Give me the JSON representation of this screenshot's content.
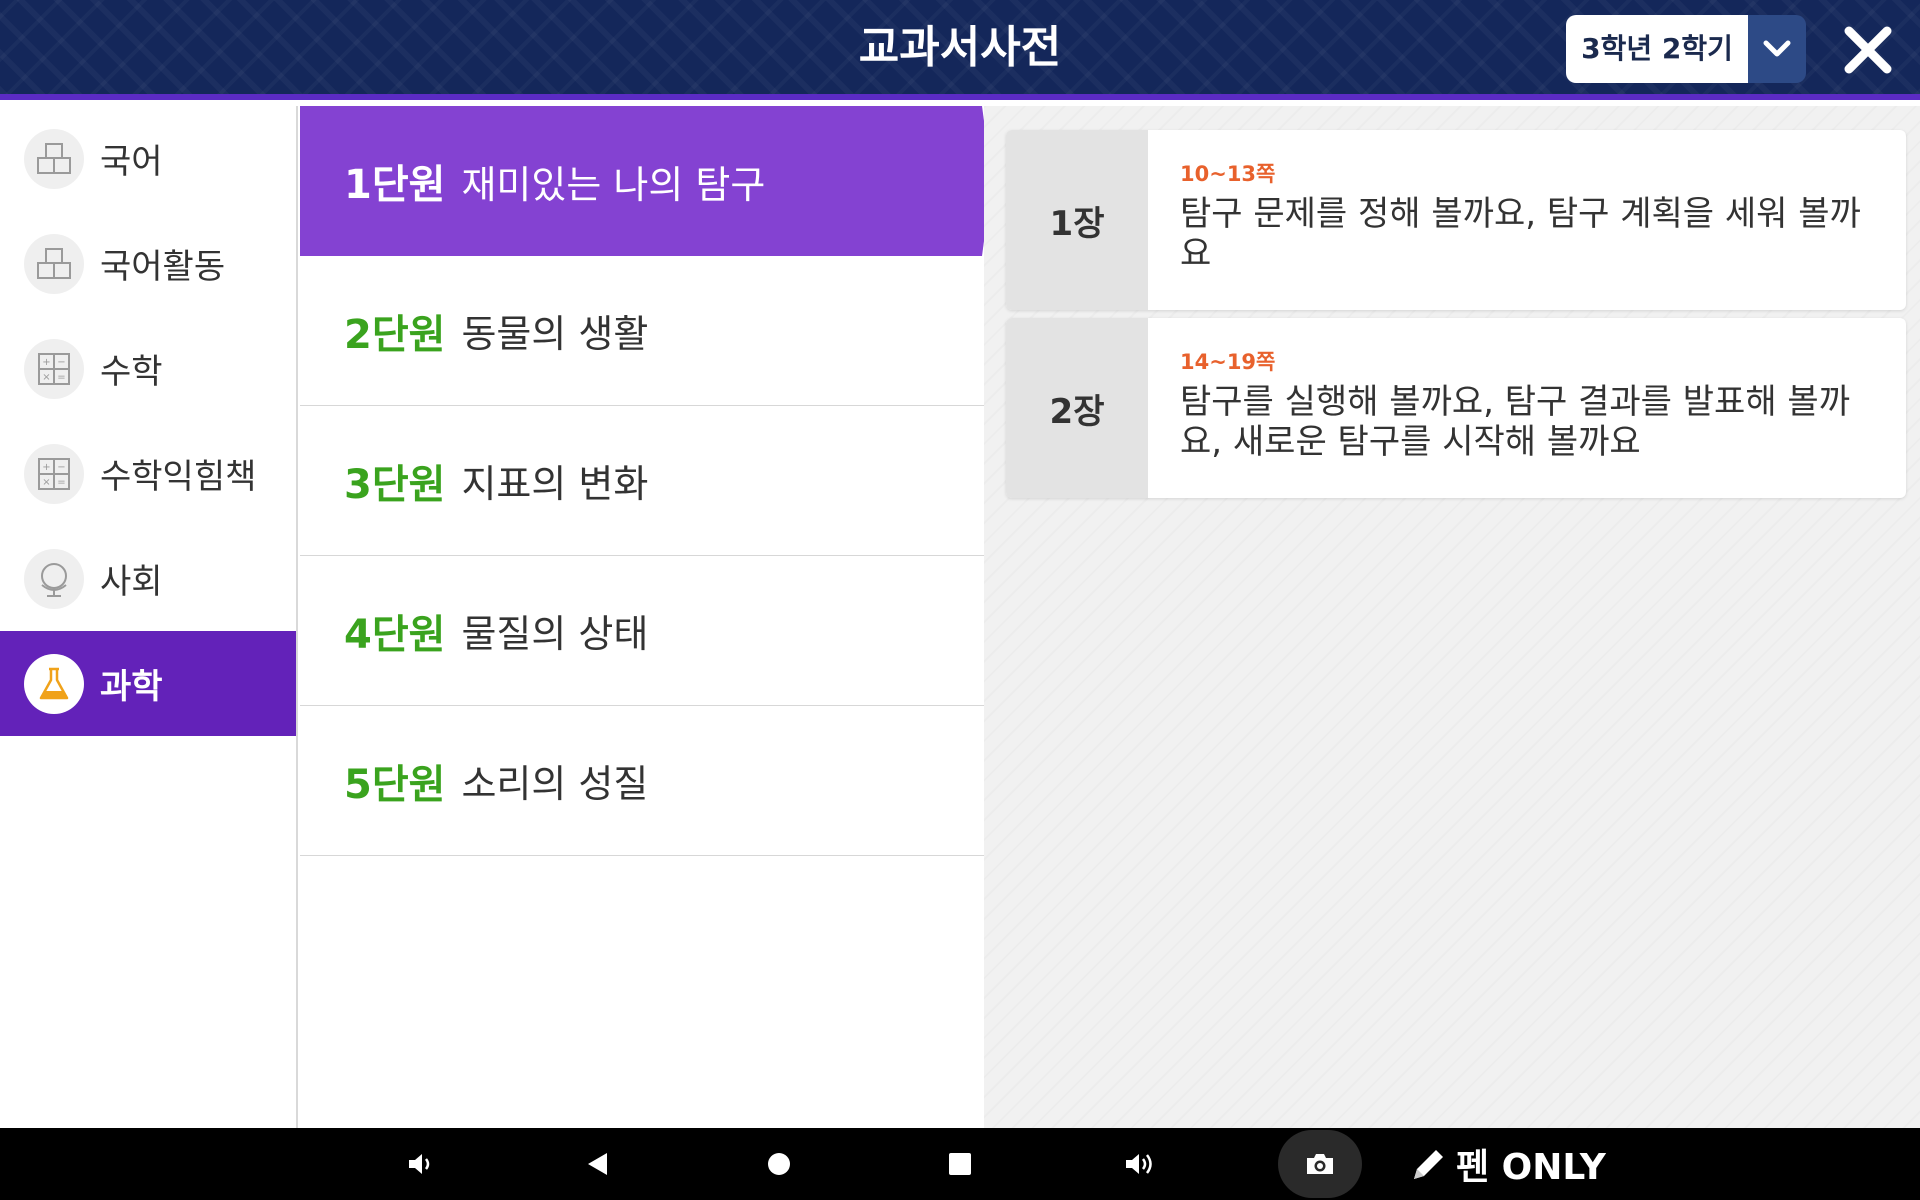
{
  "header": {
    "title": "교과서사전",
    "grade_select": "3학년 2학기",
    "accent_color": "#5b2bc4"
  },
  "subjects": [
    {
      "label": "국어",
      "icon": "textbook-icon",
      "active": false
    },
    {
      "label": "국어활동",
      "icon": "textbook-icon",
      "active": false
    },
    {
      "label": "수학",
      "icon": "calculator-icon",
      "active": false
    },
    {
      "label": "수학익힘책",
      "icon": "calculator-icon",
      "active": false
    },
    {
      "label": "사회",
      "icon": "globe-icon",
      "active": false
    },
    {
      "label": "과학",
      "icon": "flask-icon",
      "active": true
    }
  ],
  "units": [
    {
      "num": "1단원",
      "name": "재미있는 나의 탐구",
      "active": true
    },
    {
      "num": "2단원",
      "name": "동물의 생활",
      "active": false
    },
    {
      "num": "3단원",
      "name": "지표의 변화",
      "active": false
    },
    {
      "num": "4단원",
      "name": "물질의 상태",
      "active": false
    },
    {
      "num": "5단원",
      "name": "소리의 성질",
      "active": false
    }
  ],
  "chapters": [
    {
      "num": "1장",
      "pages": "10~13쪽",
      "title": "탐구 문제를 정해 볼까요, 탐구 계획을 세워 볼까요"
    },
    {
      "num": "2장",
      "pages": "14~19쪽",
      "title": "탐구를 실행해 볼까요, 탐구 결과를 발표해 볼까요, 새로운 탐구를 시작해 볼까요"
    }
  ],
  "navbar": {
    "pen_label": "펜 ONLY",
    "icons": [
      "volume-down-icon",
      "back-icon",
      "home-icon",
      "recents-icon",
      "volume-up-icon",
      "camera-icon",
      "pencil-icon"
    ]
  },
  "colors": {
    "header_bg": "#14275a",
    "subject_active": "#6322b9",
    "unit_active": "#8442d2",
    "unit_number": "#3aa31e",
    "page_range": "#e8612c"
  }
}
